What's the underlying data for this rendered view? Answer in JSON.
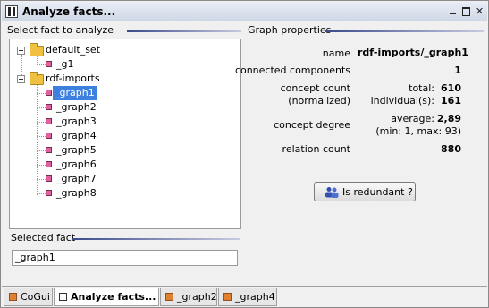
{
  "window": {
    "title": "Analyze facts..."
  },
  "left_panel": {
    "title": "Select fact to analyze",
    "tree": [
      {
        "label": "default_set",
        "type": "folder"
      },
      {
        "label": "_g1",
        "type": "graph"
      },
      {
        "label": "rdf-imports",
        "type": "folder"
      },
      {
        "label": "_graph1",
        "type": "graph",
        "selected": true
      },
      {
        "label": "_graph2",
        "type": "graph"
      },
      {
        "label": "_graph3",
        "type": "graph"
      },
      {
        "label": "_graph4",
        "type": "graph"
      },
      {
        "label": "_graph5",
        "type": "graph"
      },
      {
        "label": "_graph6",
        "type": "graph"
      },
      {
        "label": "_graph7",
        "type": "graph"
      },
      {
        "label": "_graph8",
        "type": "graph"
      }
    ],
    "selected_fact_title": "Selected fact",
    "selected_fact_value": "_graph1"
  },
  "right_panel": {
    "title": "Graph properties",
    "name_label": "name",
    "name_value": "rdf-imports/_graph1",
    "connected_label": "connected components",
    "connected_value": "1",
    "concept_count_label": "concept count",
    "concept_count_sublabel": "(normalized)",
    "total_label": "total:",
    "total_value": "610",
    "individuals_label": "individual(s):",
    "individuals_value": "161",
    "degree_label": "concept degree",
    "average_label": "average:",
    "average_value": "2,89",
    "minmax": "(min: 1, max: 93)",
    "relation_label": "relation count",
    "relation_value": "880",
    "redundant_button": "Is redundant ?"
  },
  "tabs": [
    {
      "label": "CoGui",
      "icon": "cogui-icon"
    },
    {
      "label": "Analyze facts...",
      "icon": "fact-icon",
      "active": true
    },
    {
      "label": "_graph2",
      "icon": "graph-icon"
    },
    {
      "label": "_graph4",
      "icon": "graph-icon"
    }
  ],
  "colors": {
    "selection": "#3d80df",
    "graph_node": "#e060a0",
    "folder": "#f0c040",
    "accent_line": "#3a4a8a"
  }
}
